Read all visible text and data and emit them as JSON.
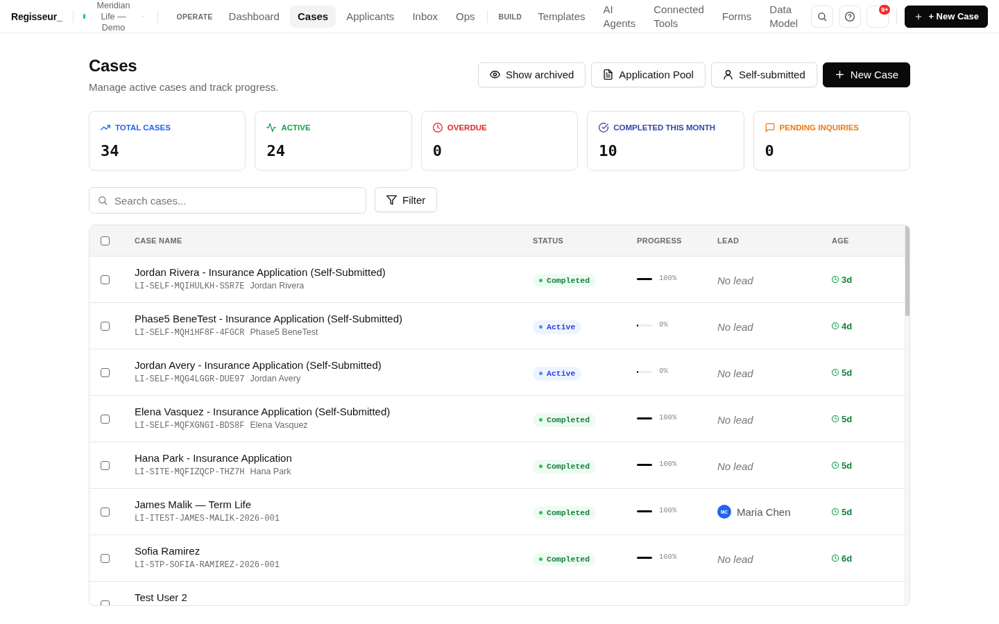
{
  "nav": {
    "logo": "Regisseur_",
    "workspace": "Meridian Life — Demo",
    "groups": [
      {
        "heading": "OPERATE",
        "items": [
          {
            "label": "Dashboard",
            "selected": false
          },
          {
            "label": "Cases",
            "selected": true
          },
          {
            "label": "Applicants",
            "selected": false
          },
          {
            "label": "Inbox",
            "selected": false
          },
          {
            "label": "Ops",
            "selected": false
          }
        ]
      },
      {
        "heading": "BUILD",
        "items": [
          {
            "label": "Templates",
            "selected": false
          },
          {
            "label": "AI Agents",
            "selected": false
          },
          {
            "label": "Connected Tools",
            "selected": false
          },
          {
            "label": "Forms",
            "selected": false
          },
          {
            "label": "Data Model",
            "selected": false
          }
        ]
      }
    ],
    "notification_badge": "9+",
    "new_case_button": "+ New Case"
  },
  "header": {
    "title": "Cases",
    "subtitle": "Manage active cases and track progress.",
    "actions": [
      {
        "label": "Show archived",
        "kind": "outline"
      },
      {
        "label": "Application Pool",
        "kind": "outline"
      },
      {
        "label": "Self-submitted",
        "kind": "outline"
      },
      {
        "label": "New Case",
        "kind": "primary"
      }
    ]
  },
  "stats": [
    {
      "label": "TOTAL CASES",
      "value": "34",
      "color": "#2563eb"
    },
    {
      "label": "ACTIVE",
      "value": "24",
      "color": "#16a34a"
    },
    {
      "label": "OVERDUE",
      "value": "0",
      "color": "#dc2626"
    },
    {
      "label": "COMPLETED THIS MONTH",
      "value": "10",
      "color": "#3445a8"
    },
    {
      "label": "PENDING INQUIRIES",
      "value": "0",
      "color": "#ea7a0c"
    }
  ],
  "search": {
    "placeholder": "Search cases..."
  },
  "filter_button": "Filter",
  "table": {
    "select_all": {
      "checked": false
    },
    "columns": [
      "CASE NAME",
      "STATUS",
      "PROGRESS",
      "LEAD",
      "AGE"
    ],
    "rows": [
      {
        "checked": false,
        "name": "Jordan Rivera - Insurance Application (Self-Submitted)",
        "code": "LI-SELF-MQIHULKH-SSR7E",
        "applicant": "Jordan Rivera",
        "status": {
          "label": "Completed",
          "kind": "completed"
        },
        "level": 1,
        "progress": "100%",
        "lead": {
          "kind": "none",
          "label": "No lead"
        },
        "age": "3d"
      },
      {
        "checked": false,
        "name": "Phase5 BeneTest - Insurance Application (Self-Submitted)",
        "code": "LI-SELF-MQH1HF8F-4FGCR",
        "applicant": "Phase5 BeneTest",
        "status": {
          "label": "Active",
          "kind": "active"
        },
        "level": 0.09,
        "progress": "9%",
        "lead": {
          "kind": "none",
          "label": "No lead"
        },
        "age": "4d"
      },
      {
        "checked": false,
        "name": "Jordan Avery - Insurance Application (Self-Submitted)",
        "code": "LI-SELF-MQG4LGGR-DUE97",
        "applicant": "Jordan Avery",
        "status": {
          "label": "Active",
          "kind": "active"
        },
        "level": 0.09,
        "progress": "9%",
        "lead": {
          "kind": "none",
          "label": "No lead"
        },
        "age": "5d"
      },
      {
        "checked": false,
        "name": "Elena Vasquez - Insurance Application (Self-Submitted)",
        "code": "LI-SELF-MQFXGNGI-BDS8F",
        "applicant": "Elena Vasquez",
        "status": {
          "label": "Completed",
          "kind": "completed"
        },
        "level": 1,
        "progress": "100%",
        "lead": {
          "kind": "none",
          "label": "No lead"
        },
        "age": "5d"
      },
      {
        "checked": false,
        "name": "Hana Park - Insurance Application",
        "code": "LI-SITE-MQFIZQCP-THZ7H",
        "applicant": "Hana Park",
        "status": {
          "label": "Completed",
          "kind": "completed"
        },
        "level": 1,
        "progress": "100%",
        "lead": {
          "kind": "none",
          "label": "No lead"
        },
        "age": "5d"
      },
      {
        "checked": false,
        "name": "James Malik — Term Life",
        "code": "LI-ITEST-JAMES-MALIK-2026-001",
        "status": {
          "label": "Completed",
          "kind": "completed"
        },
        "level": 1,
        "progress": "100%",
        "lead": {
          "kind": "person",
          "initials": "MC",
          "label": "Maria Chen"
        },
        "age": "5d"
      },
      {
        "checked": false,
        "name": "Sofia Ramirez",
        "code": "LI-STP-SOFIA-RAMIREZ-2026-001",
        "status": {
          "label": "Completed",
          "kind": "completed"
        },
        "level": 1,
        "progress": "100%",
        "lead": {
          "kind": "none",
          "label": "No lead"
        },
        "age": "6d"
      },
      {
        "checked": false,
        "name": "Test User 2"
      }
    ]
  }
}
